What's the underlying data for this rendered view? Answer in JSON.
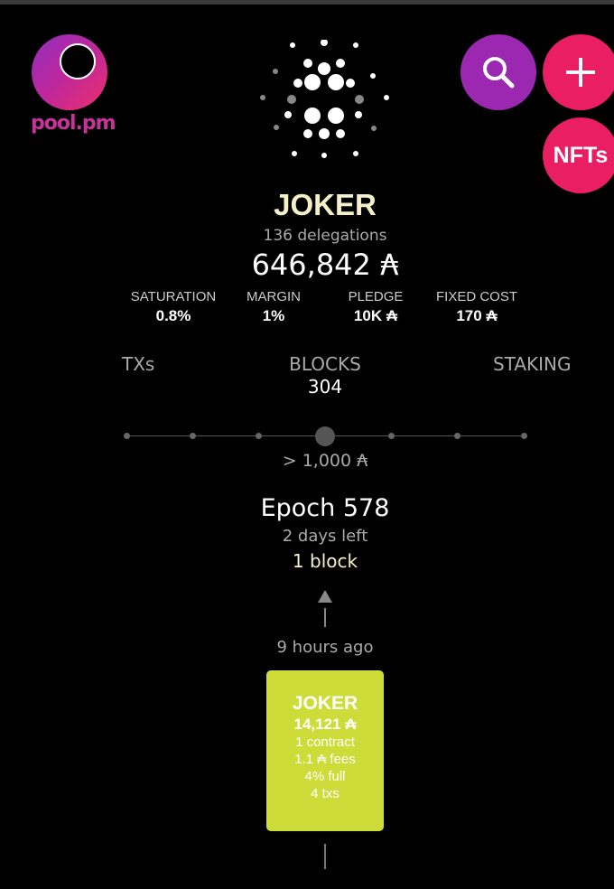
{
  "logo": {
    "text": "pool.pm"
  },
  "buttons": {
    "nfts_label": "NFTs"
  },
  "pool": {
    "name": "JOKER",
    "delegations": "136 delegations",
    "stake": "646,842 ₳",
    "stats": [
      {
        "label": "SATURATION",
        "value": "0.8%"
      },
      {
        "label": "MARGIN",
        "value": "1%"
      },
      {
        "label": "PLEDGE",
        "value": "10K ₳"
      },
      {
        "label": "FIXED COST",
        "value": "170 ₳"
      }
    ]
  },
  "tabs": {
    "txs": "TXs",
    "blocks": "BLOCKS",
    "blocks_count": "304",
    "staking": "STAKING"
  },
  "filter": {
    "label": "> 1,000 ₳",
    "selected_index": 3,
    "stops": 7
  },
  "epoch": {
    "title": "Epoch 578",
    "days_left": "2 days left",
    "blocks": "1 block"
  },
  "latest_block": {
    "time_ago": "9 hours ago",
    "pool": "JOKER",
    "amount": "14,121 ₳",
    "contracts": "1 contract",
    "fees": "1.1 ₳ fees",
    "full": "4% full",
    "txs": "4 txs"
  },
  "colors": {
    "background": "#000000",
    "search_button": "#9c27b0",
    "pink_button": "#e91e63",
    "block_card": "#cddc39",
    "pool_name": "#f5f0c8"
  },
  "icons": [
    "pool-pm-logo-icon",
    "cardano-logo-icon",
    "search-icon",
    "plus-icon",
    "arrow-up-icon"
  ]
}
